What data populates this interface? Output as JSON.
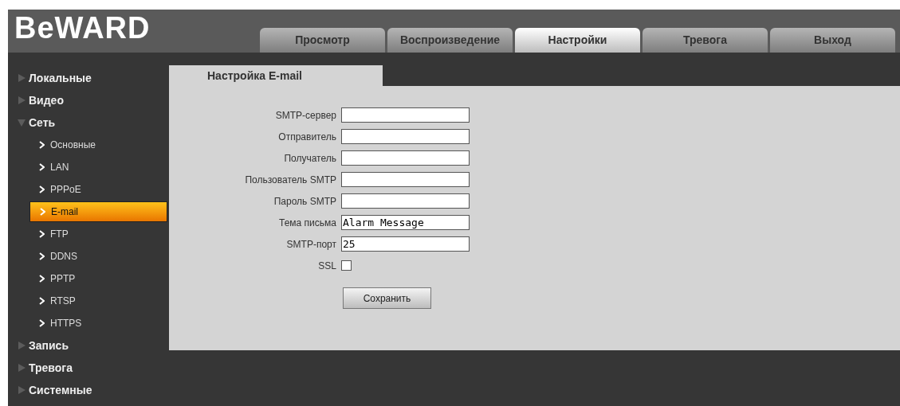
{
  "logo": "BeWARD",
  "tabs": [
    {
      "label": "Просмотр",
      "selected": false
    },
    {
      "label": "Воспроизведение",
      "selected": false
    },
    {
      "label": "Настройки",
      "selected": true
    },
    {
      "label": "Тревога",
      "selected": false
    },
    {
      "label": "Выход",
      "selected": false
    }
  ],
  "sidebar": {
    "items": [
      {
        "label": "Локальные",
        "expanded": false
      },
      {
        "label": "Видео",
        "expanded": false
      },
      {
        "label": "Сеть",
        "expanded": true,
        "children": [
          {
            "label": "Основные",
            "selected": false
          },
          {
            "label": "LAN",
            "selected": false
          },
          {
            "label": "PPPoE",
            "selected": false
          },
          {
            "label": "E-mail",
            "selected": true
          },
          {
            "label": "FTP",
            "selected": false
          },
          {
            "label": "DDNS",
            "selected": false
          },
          {
            "label": "PPTP",
            "selected": false
          },
          {
            "label": "RTSP",
            "selected": false
          },
          {
            "label": "HTTPS",
            "selected": false
          }
        ]
      },
      {
        "label": "Запись",
        "expanded": false
      },
      {
        "label": "Тревога",
        "expanded": false
      },
      {
        "label": "Системные",
        "expanded": false
      }
    ]
  },
  "panel": {
    "title": "Настройка E-mail",
    "fields": [
      {
        "kind": "text",
        "label": "SMTP-сервер"
      },
      {
        "kind": "text",
        "label": "Отправитель"
      },
      {
        "kind": "text",
        "label": "Получатель"
      },
      {
        "kind": "text",
        "label": "Пользователь SMTP"
      },
      {
        "kind": "text",
        "label": "Пароль SMTP"
      },
      {
        "kind": "text",
        "label": "Тема письма",
        "value": "Alarm Message"
      },
      {
        "kind": "text",
        "label": "SMTP-порт",
        "value": "25"
      },
      {
        "kind": "checkbox",
        "label": "SSL",
        "checked": false
      }
    ],
    "save_button": "Сохранить"
  }
}
